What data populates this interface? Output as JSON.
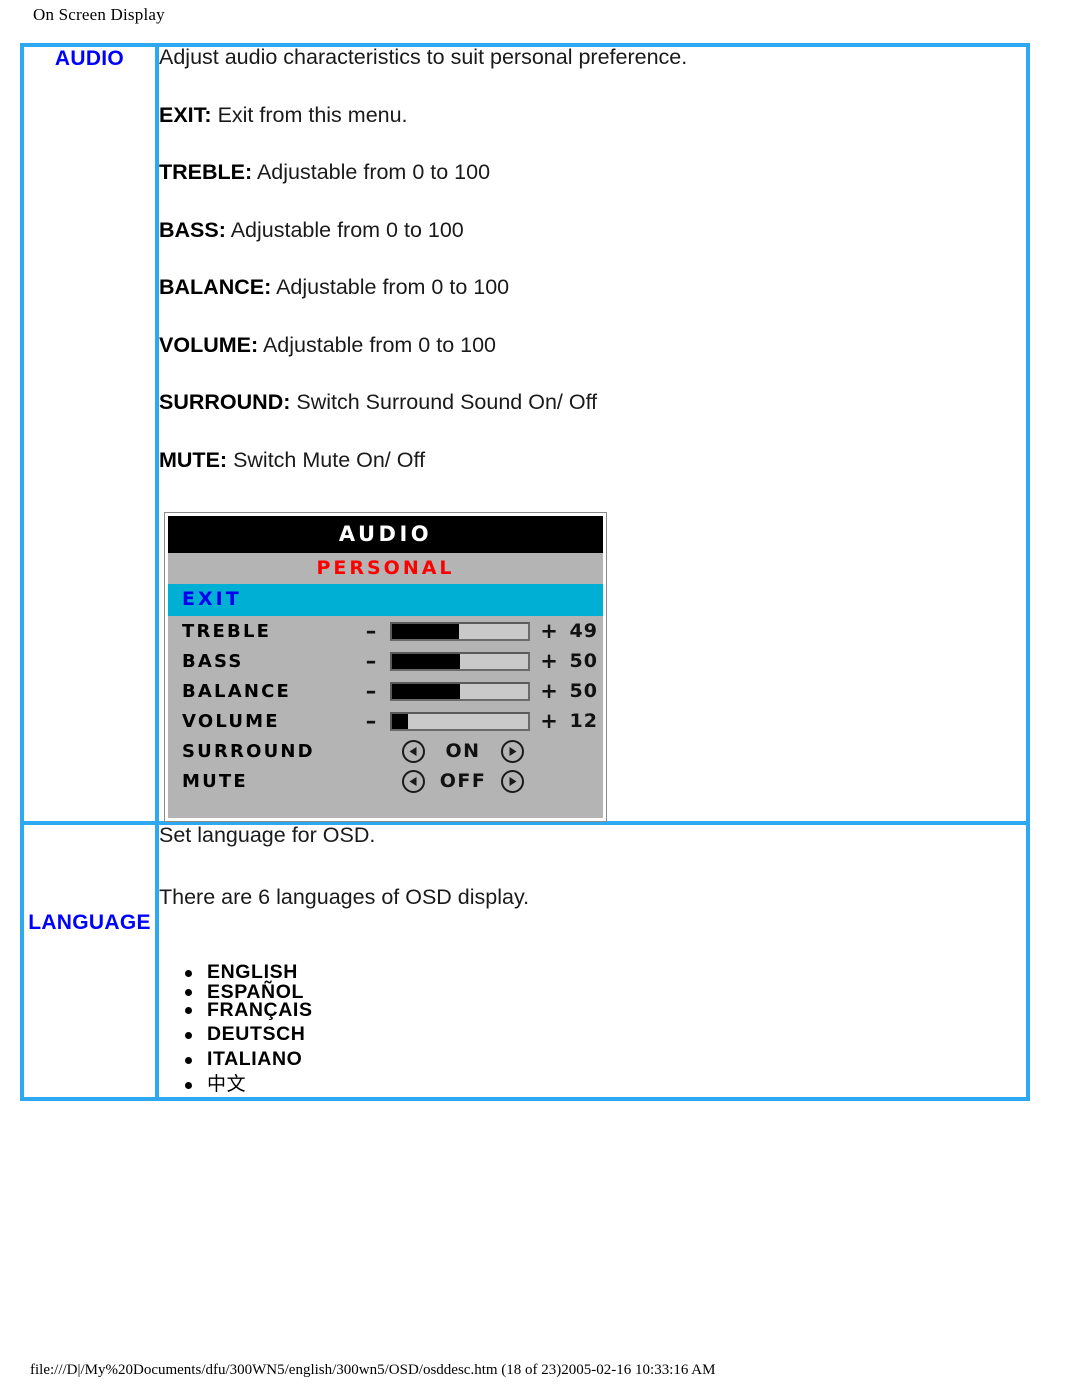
{
  "page": {
    "header_title": "On Screen Display",
    "footer_path": "file:///D|/My%20Documents/dfu/300WN5/english/300wn5/OSD/osddesc.htm (18 of 23)2005-02-16 10:33:16 AM"
  },
  "colors": {
    "table_border": "#2EA8F0",
    "section_label": "#0000FF",
    "osd_highlight": "#00AFD4",
    "osd_subtitle": "#FF0000",
    "osd_background": "#b4b4b4",
    "osd_titlebar": "#000000"
  },
  "sections": [
    {
      "label": "AUDIO",
      "intro": "Adjust audio characteristics to suit personal preference.",
      "items": [
        {
          "term": "EXIT:",
          "desc": "Exit from this menu."
        },
        {
          "term": "TREBLE:",
          "desc": "Adjustable from 0 to 100"
        },
        {
          "term": "BASS:",
          "desc": "Adjustable from 0 to 100"
        },
        {
          "term": "BALANCE:",
          "desc": "Adjustable from 0 to 100"
        },
        {
          "term": "VOLUME:",
          "desc": "Adjustable from 0 to 100"
        },
        {
          "term": "SURROUND:",
          "desc": "Switch Surround Sound On/ Off"
        },
        {
          "term": "MUTE:",
          "desc": "Switch Mute On/ Off"
        }
      ]
    },
    {
      "label": "LANGUAGE",
      "line1": "Set language for OSD.",
      "line2": "There are 6 languages of OSD display.",
      "languages": [
        "ENGLISH",
        "ESPAÑOL",
        "FRANÇAIS",
        "DEUTSCH",
        "ITALIANO",
        "中文"
      ]
    }
  ],
  "osd": {
    "title": "AUDIO",
    "subtitle": "PERSONAL",
    "exit_label": "EXIT",
    "sliders": [
      {
        "name": "TREBLE",
        "minus": "–",
        "plus": "+",
        "value": "49",
        "percent": 49
      },
      {
        "name": "BASS",
        "minus": "–",
        "plus": "+",
        "value": "50",
        "percent": 50
      },
      {
        "name": "BALANCE",
        "minus": "–",
        "plus": "+",
        "value": "50",
        "percent": 50
      },
      {
        "name": "VOLUME",
        "minus": "–",
        "plus": "+",
        "value": "12",
        "percent": 12
      }
    ],
    "toggles": [
      {
        "name": "SURROUND",
        "state": "ON"
      },
      {
        "name": "MUTE",
        "state": "OFF"
      }
    ]
  }
}
